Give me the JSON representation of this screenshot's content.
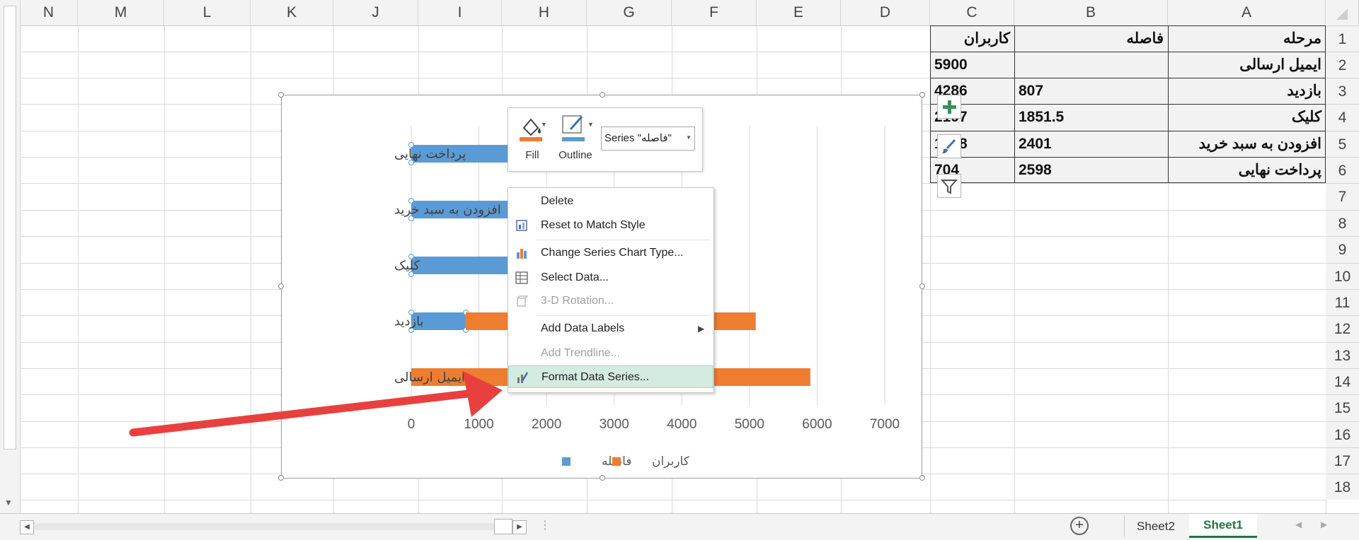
{
  "columns": [
    "N",
    "M",
    "L",
    "K",
    "J",
    "I",
    "H",
    "G",
    "F",
    "E",
    "D",
    "C",
    "B",
    "A"
  ],
  "rows": [
    "1",
    "2",
    "3",
    "4",
    "5",
    "6",
    "7",
    "8",
    "9",
    "10",
    "11",
    "12",
    "13",
    "14",
    "15",
    "16",
    "17",
    "18"
  ],
  "table": {
    "headers": {
      "a": "مرحله",
      "b": "فاصله",
      "c": "کاربران"
    },
    "rows": [
      {
        "a": "ایمیل ارسالی",
        "b": "",
        "c": "5900"
      },
      {
        "a": "بازدید",
        "b": "807",
        "c": "4286"
      },
      {
        "a": "کلیک",
        "b": "1851.5",
        "c": "2197"
      },
      {
        "a": "افزودن به سبد خرید",
        "b": "2401",
        "c": "1098"
      },
      {
        "a": "پرداخت نهایی",
        "b": "2598",
        "c": "704"
      }
    ]
  },
  "chart_data": {
    "type": "bar",
    "orientation": "horizontal-stacked",
    "categories": [
      "ایمیل ارسالی",
      "بازدید",
      "کلیک",
      "افزودن به سبد خرید",
      "پرداخت نهایی"
    ],
    "series": [
      {
        "name": "فاصله",
        "color": "#5b9bd5",
        "values": [
          0,
          807,
          1851.5,
          2401,
          2598
        ]
      },
      {
        "name": "کاربران",
        "color": "#ed7d31",
        "values": [
          5900,
          4286,
          2197,
          1098,
          704
        ]
      }
    ],
    "x_ticks": [
      "0",
      "1000",
      "2000",
      "3000",
      "4000",
      "5000",
      "6000",
      "7000"
    ],
    "xlim": [
      0,
      7000
    ],
    "legend_position": "bottom"
  },
  "minibar": {
    "fill_label": "Fill",
    "outline_label": "Outline",
    "series_select": "Series \"فاصله\""
  },
  "context_menu": {
    "items": [
      {
        "label": "Delete",
        "icon": "none",
        "disabled": false
      },
      {
        "label": "Reset to Match Style",
        "icon": "reset-style-icon",
        "disabled": false
      },
      {
        "label": "Change Series Chart Type...",
        "icon": "chart-type-icon",
        "disabled": false
      },
      {
        "label": "Select Data...",
        "icon": "select-data-icon",
        "disabled": false
      },
      {
        "label": "3-D Rotation...",
        "icon": "rotation-icon",
        "disabled": true
      },
      {
        "label": "Add Data Labels",
        "icon": "none",
        "disabled": false
      },
      {
        "label": "Add Trendline...",
        "icon": "none",
        "disabled": true
      },
      {
        "label": "Format Data Series...",
        "icon": "format-series-icon",
        "disabled": false
      }
    ]
  },
  "sheet_tabs": {
    "add_icon": "plus-circle-icon",
    "tabs": [
      "Sheet2",
      "Sheet1"
    ],
    "active": "Sheet1"
  },
  "colors": {
    "accent_green": "#217346",
    "arrow_red": "#e8403f",
    "highlight": "#d4ebe0"
  }
}
